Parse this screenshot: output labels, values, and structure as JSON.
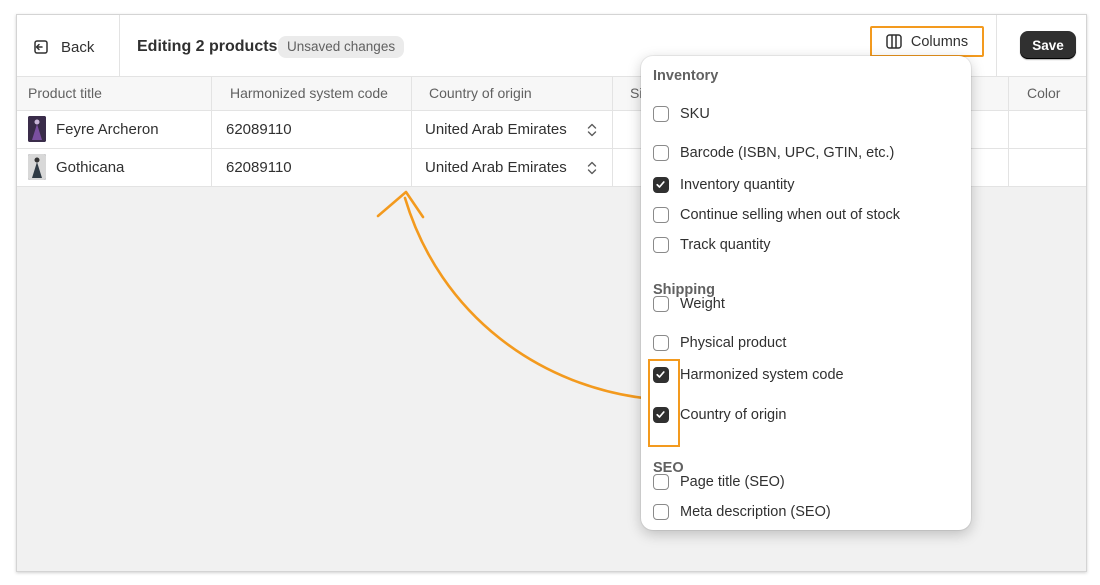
{
  "topbar": {
    "back_label": "Back",
    "title": "Editing 2 products",
    "badge": "Unsaved changes",
    "columns_label": "Columns",
    "save_label": "Save"
  },
  "table": {
    "headers": [
      "Product title",
      "Harmonized system code",
      "Country of origin",
      "Size",
      "Color"
    ],
    "rows": [
      {
        "title": "Feyre Archeron",
        "hs_code": "62089110",
        "country": "United Arab Emirates"
      },
      {
        "title": "Gothicana",
        "hs_code": "62089110",
        "country": "United Arab Emirates"
      }
    ]
  },
  "columns_menu": {
    "groups": [
      {
        "title": "Inventory",
        "options": [
          {
            "label": "SKU",
            "checked": false
          },
          {
            "label": "Barcode (ISBN, UPC, GTIN, etc.)",
            "checked": false
          },
          {
            "label": "Inventory quantity",
            "checked": true
          },
          {
            "label": "Continue selling when out of stock",
            "checked": false
          },
          {
            "label": "Track quantity",
            "checked": false
          }
        ]
      },
      {
        "title": "Shipping",
        "options": [
          {
            "label": "Weight",
            "checked": false
          },
          {
            "label": "Physical product",
            "checked": false
          },
          {
            "label": "Harmonized system code",
            "checked": true
          },
          {
            "label": "Country of origin",
            "checked": true
          }
        ]
      },
      {
        "title": "SEO",
        "options": [
          {
            "label": "Page title (SEO)",
            "checked": false
          },
          {
            "label": "Meta description (SEO)",
            "checked": false
          }
        ]
      }
    ]
  },
  "colors": {
    "highlight": "#f39a1e",
    "primary_button": "#303030",
    "checkbox_checked": "#303030"
  }
}
